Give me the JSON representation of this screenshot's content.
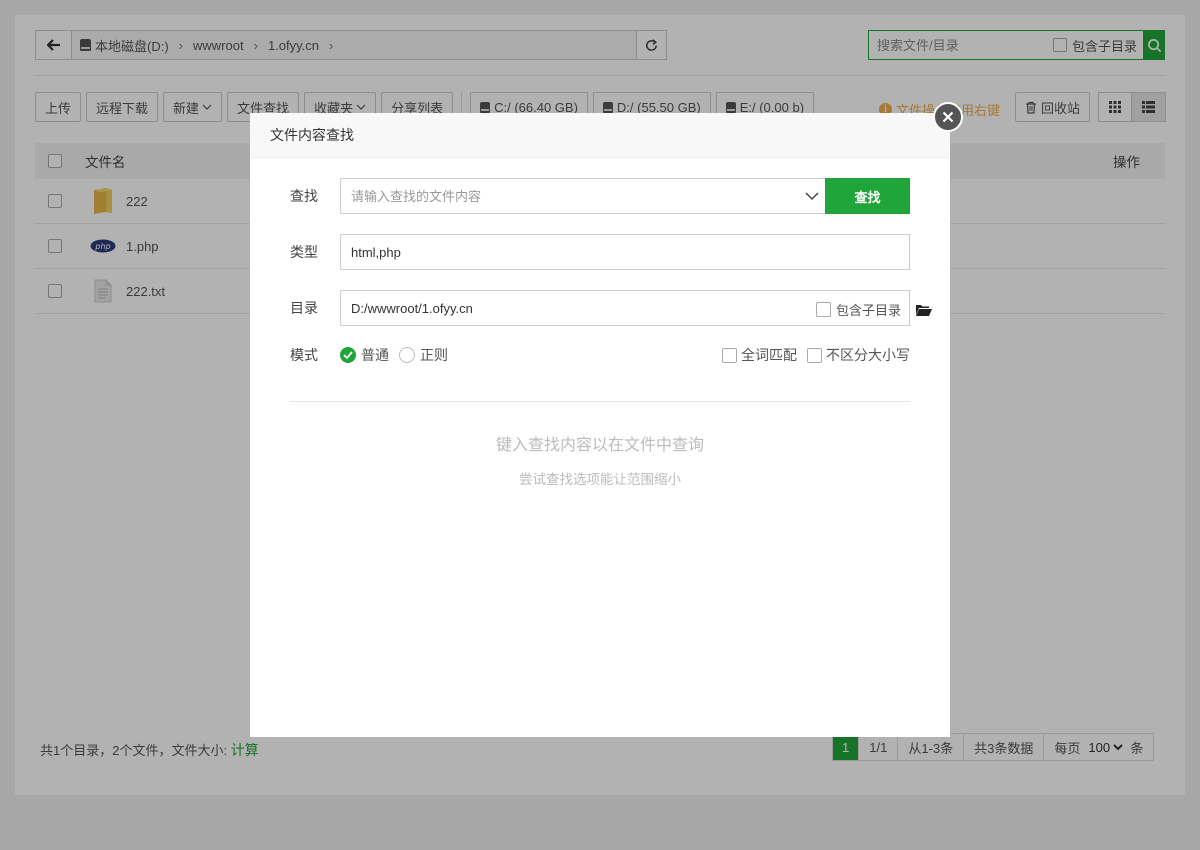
{
  "path_bar": {
    "crumbs": [
      "本地磁盘(D:)",
      "wwwroot",
      "1.ofyy.cn"
    ]
  },
  "search": {
    "placeholder": "搜索文件/目录",
    "include_sub": "包含子目录"
  },
  "toolbar": {
    "upload": "上传",
    "remote_download": "远程下载",
    "new": "新建",
    "file_search": "文件查找",
    "favorites": "收藏夹",
    "share_list": "分享列表",
    "disks": [
      "C:/ (66.40 GB)",
      "D:/ (55.50 GB)",
      "E:/ (0.00 b)"
    ],
    "tip": "文件操作使用右键",
    "recycle": "回收站"
  },
  "table": {
    "col_name": "文件名",
    "col_ops": "操作",
    "rows": [
      {
        "name": "222",
        "type": "folder"
      },
      {
        "name": "1.php",
        "type": "php"
      },
      {
        "name": "222.txt",
        "type": "txt"
      }
    ]
  },
  "footer": {
    "summary": "共1个目录，2个文件，文件大小: ",
    "calc_link": "计算"
  },
  "pager": {
    "current": "1",
    "pages": "1/1",
    "range": "从1-3条",
    "total": "共3条数据",
    "per_page_label": "每页",
    "per_page_value": "100",
    "per_page_unit": "条"
  },
  "modal": {
    "title": "文件内容查找",
    "search_label": "查找",
    "search_placeholder": "请输入查找的文件内容",
    "search_button": "查找",
    "type_label": "类型",
    "type_value": "html,php",
    "dir_label": "目录",
    "dir_value": "D:/wwwroot/1.ofyy.cn",
    "dir_include_sub": "包含子目录",
    "mode_label": "模式",
    "mode_normal": "普通",
    "mode_regex": "正则",
    "whole_word": "全词匹配",
    "ignore_case": "不区分大小写",
    "empty_title": "键入查找内容以在文件中查询",
    "empty_sub": "尝试查找选项能让范围缩小"
  },
  "colors": {
    "accent": "#20a53a",
    "tip": "#f0ad4e"
  }
}
